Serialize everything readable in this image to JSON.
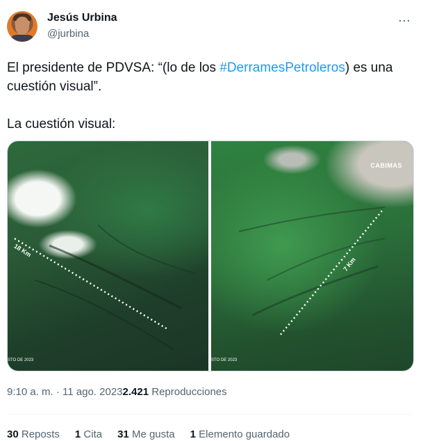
{
  "author": {
    "name": "Jesús Urbina",
    "handle": "@jurbina"
  },
  "more_icon": "⋯",
  "tweet": {
    "line1_prefix": "El presidente de PDVSA: “(lo de los ",
    "hashtag": "#DerramesPetroleros",
    "line1_suffix": ") es una cuestión visual”.",
    "line2": "La cuestión visual:"
  },
  "media": {
    "left": {
      "scale": "18 Km",
      "date": "STO DE 2023"
    },
    "right": {
      "scale": "7 Km",
      "city": "CABIMAS",
      "date": "STO DE 2023"
    }
  },
  "meta": {
    "time": "9:10 a. m. · 11 ago. 2023",
    "views_count": "2.421",
    "views_label": " Reproducciones"
  },
  "stats": {
    "reposts_count": "30",
    "reposts_label": "Reposts",
    "quotes_count": "1",
    "quotes_label": "Cita",
    "likes_count": "31",
    "likes_label": "Me gusta",
    "saves_count": "1",
    "saves_label": "Elemento guardado"
  }
}
